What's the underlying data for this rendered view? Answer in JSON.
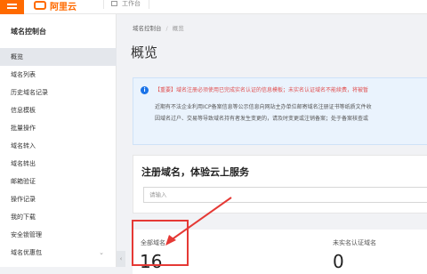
{
  "topbar": {
    "logo_text": "阿里云",
    "nav_label": "工作台",
    "brand_color": "#ff6a00"
  },
  "sidebar": {
    "title": "域名控制台",
    "items": [
      {
        "label": "概览",
        "active": true
      },
      {
        "label": "域名列表"
      },
      {
        "label": "历史域名记录"
      },
      {
        "label": "信息模板"
      },
      {
        "label": "批量操作"
      },
      {
        "label": "域名转入"
      },
      {
        "label": "域名转出"
      },
      {
        "label": "邮箱验证"
      },
      {
        "label": "操作记录"
      },
      {
        "label": "我的下载"
      },
      {
        "label": "安全锁管理"
      },
      {
        "label": "域名优惠包",
        "chevron": "chevron-down-icon"
      }
    ],
    "collapse_glyph": "‹"
  },
  "breadcrumb": {
    "root": "域名控制台",
    "separator": "/",
    "current": "概览"
  },
  "page_title": "概览",
  "notice": {
    "icon": "info-icon",
    "line1": "【重要】域名注册必须使用已完成实名认证的信息模板；未实名认证域名不能续费，将被暂",
    "line2": "近期有不法企业利用ICP备案信息等公示信息向网站主办单位邮寄域名注册证书等纸质文件收",
    "line3": "因域名过户、交易等导致域名持有者发生变更的，请及时变更或注销备案；处于备案核查或"
  },
  "register": {
    "title": "注册域名，体验云上服务",
    "placeholder": "请输入"
  },
  "stats": [
    {
      "label": "全部域名",
      "value": "16"
    },
    {
      "label": "未实名认证域名",
      "value": "0"
    }
  ],
  "colors": {
    "annotation_red": "#e53935",
    "notice_text_red": "#e15050",
    "info_blue": "#1a73e8"
  }
}
